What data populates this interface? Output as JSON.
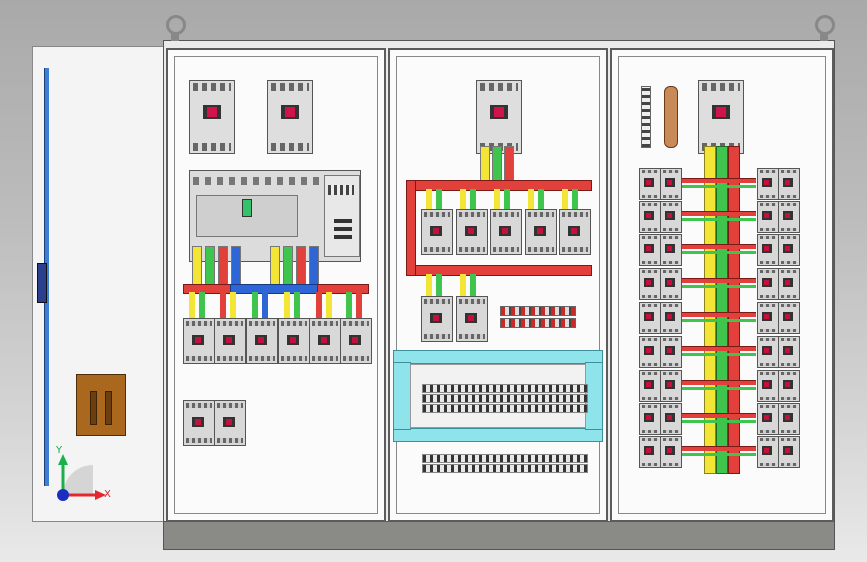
{
  "axis_triad": {
    "x_label": "X",
    "y_label": "Y"
  },
  "colors": {
    "phase_red": "#e2413b",
    "phase_yellow": "#f2e536",
    "phase_green": "#3fc44d",
    "phase_blue": "#2f66d6",
    "busbar_copper": "#c98a5a",
    "cyan_duct": "#8fe3ea",
    "pocket_brown": "#a9681e",
    "door_blue": "#3f7fd3"
  },
  "icons": [
    "lifting-eye-icon",
    "axis-triad-icon",
    "breaker-icon",
    "busbar-icon"
  ]
}
